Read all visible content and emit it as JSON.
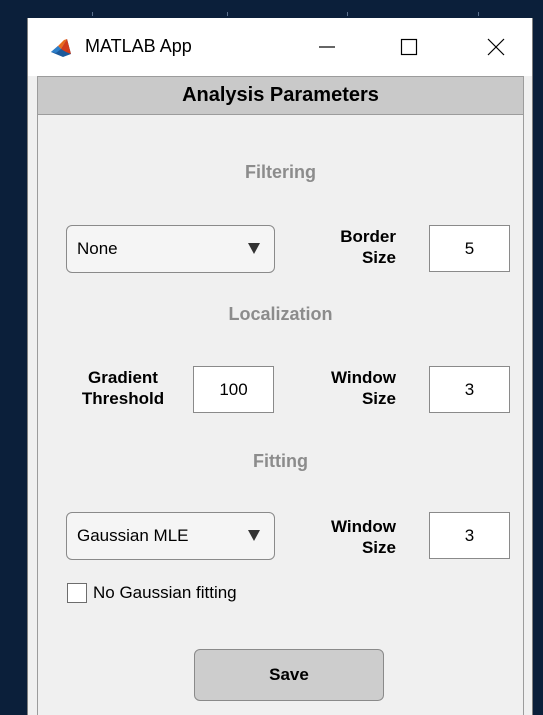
{
  "window": {
    "title": "MATLAB App",
    "header": "Analysis Parameters"
  },
  "filtering": {
    "section_title": "Filtering",
    "dropdown_value": "None",
    "border_label_line1": "Border",
    "border_label_line2": "Size",
    "border_value": "5"
  },
  "localization": {
    "section_title": "Localization",
    "gradient_label_line1": "Gradient",
    "gradient_label_line2": "Threshold",
    "gradient_value": "100",
    "window_label_line1": "Window",
    "window_label_line2": "Size",
    "window_value": "3"
  },
  "fitting": {
    "section_title": "Fitting",
    "dropdown_value": "Gaussian MLE",
    "window_label_line1": "Window",
    "window_label_line2": "Size",
    "window_value": "3",
    "checkbox_label": "No Gaussian fitting",
    "checkbox_checked": false
  },
  "actions": {
    "save_label": "Save"
  },
  "icons": {
    "app": "matlab-logo-icon",
    "minimize": "minimize-icon",
    "maximize": "maximize-icon",
    "close": "close-icon",
    "dropdown_arrow": "triangle-down-icon"
  },
  "colors": {
    "desktop": "#0b1f3a",
    "window_bg": "#f0f0f0",
    "header_bg": "#c9c9c9",
    "section_title": "#8c8c8c",
    "button_bg": "#cdcdcd"
  }
}
